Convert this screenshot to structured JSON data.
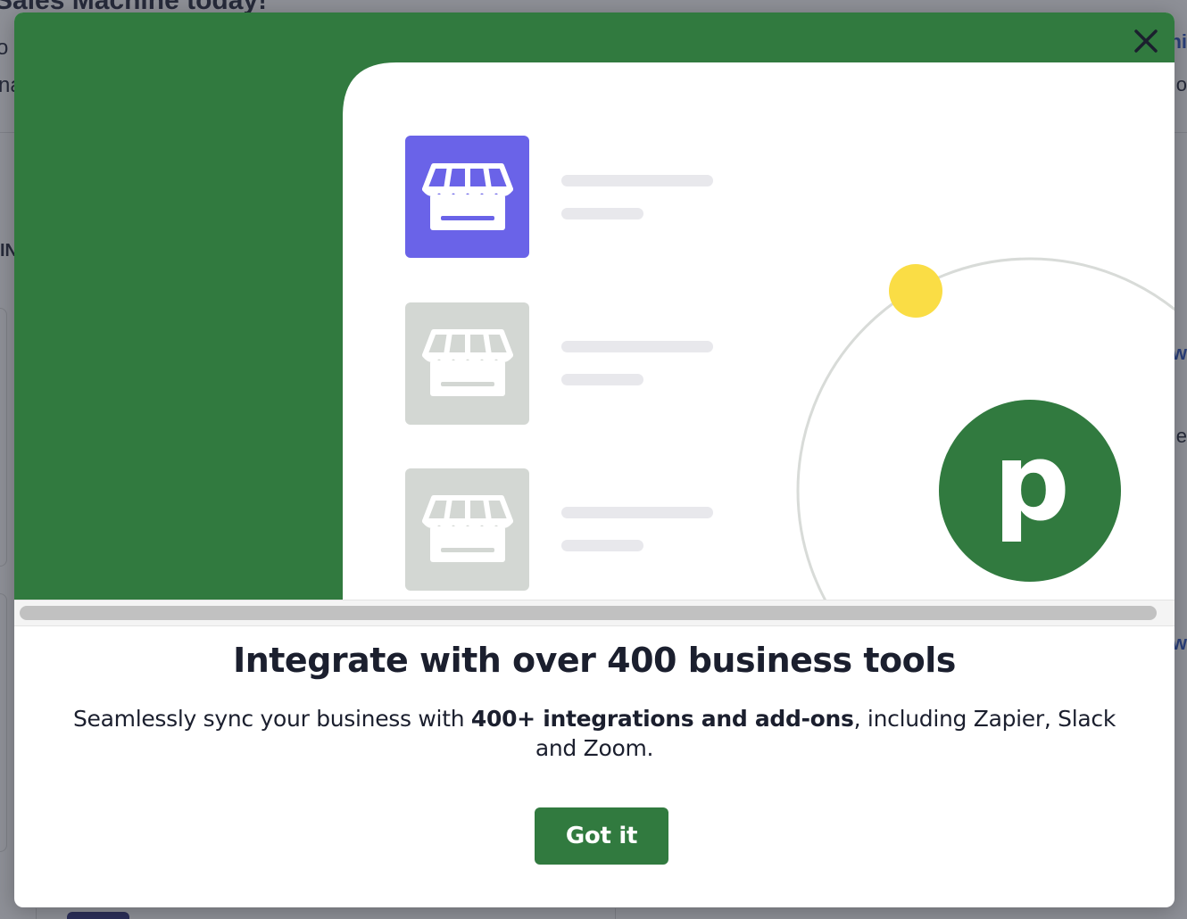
{
  "background": {
    "headline": "Sales Machine today!",
    "fragment_line1": "o I",
    "fragment_line2": "na",
    "fragment_tab": "IN",
    "fragment_right1": "ni",
    "fragment_right2": "o",
    "fragment_right3": "w",
    "fragment_right4": "e",
    "fragment_right5": "w"
  },
  "modal": {
    "close_icon": "close-icon",
    "title": "Integrate with over 400 business tools",
    "description_before": "Seamlessly sync your business with ",
    "description_bold": "400+ integrations and add-ons",
    "description_after": ", including Zapier, Slack and Zoom.",
    "cta_label": "Got it",
    "logo_letter": "p"
  },
  "colors": {
    "brand_green": "#317a3f",
    "accent_purple": "#6a63e8",
    "accent_yellow": "#fadd45",
    "inactive_tile": "#d3d7d3"
  },
  "icons": {
    "store_icon": "storefront-icon"
  }
}
